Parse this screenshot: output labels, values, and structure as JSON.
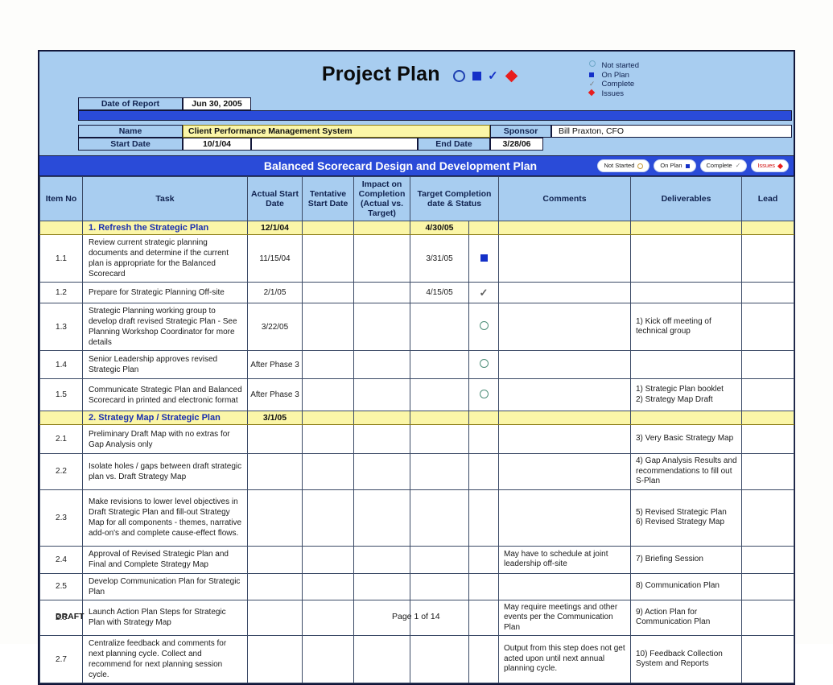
{
  "document": {
    "title": "Project Plan",
    "title_icons": [
      "not-started-circle",
      "on-plan-square",
      "complete-check",
      "issues-diamond"
    ]
  },
  "legend": {
    "items": [
      {
        "icon": "circle-outline",
        "label": "Not started"
      },
      {
        "icon": "blue-square",
        "label": "On Plan"
      },
      {
        "icon": "check",
        "label": "Complete"
      },
      {
        "icon": "red-diamond",
        "label": "Issues"
      }
    ]
  },
  "info": {
    "date_of_report_label": "Date of Report",
    "date_of_report_value": "Jun 30, 2005",
    "name_label": "Name",
    "name_value": "Client Performance Management System",
    "sponsor_label": "Sponsor",
    "sponsor_value": "Bill Praxton, CFO",
    "start_date_label": "Start Date",
    "start_date_value": "10/1/04",
    "end_date_label": "End Date",
    "end_date_value": "3/28/06"
  },
  "plan_bar": {
    "title": "Balanced Scorecard Design and Development Plan",
    "pills": [
      {
        "label": "Not Started",
        "icon": "circle-outline"
      },
      {
        "label": "On Plan",
        "icon": "blue-square"
      },
      {
        "label": "Complete",
        "icon": "check"
      },
      {
        "label": "Issues",
        "icon": "red-diamond"
      }
    ]
  },
  "table": {
    "headers": {
      "item_no": "Item No",
      "task": "Task",
      "actual_start_date": "Actual Start Date",
      "tentative_start_date": "Tentative Start Date",
      "impact_on_completion": "Impact on Completion (Actual vs. Target)",
      "target_completion": "Target Completion date & Status",
      "comments": "Comments",
      "deliverables": "Deliverables",
      "lead": "Lead"
    },
    "sections": [
      {
        "title": "1. Refresh the Strategic Plan",
        "actual_start": "12/1/04",
        "target_completion": "4/30/05",
        "rows": [
          {
            "item_no": "1.1",
            "task": "Review current strategic planning documents and determine if the current plan is appropriate for the Balanced Scorecard",
            "actual_start": "11/15/04",
            "tentative_start": "",
            "impact": "",
            "target_date": "3/31/05",
            "status": "on-plan",
            "comments": "",
            "deliverables": "",
            "lead": ""
          },
          {
            "item_no": "1.2",
            "task": "Prepare for Strategic Planning Off-site",
            "actual_start": "2/1/05",
            "tentative_start": "",
            "impact": "",
            "target_date": "4/15/05",
            "status": "complete",
            "comments": "",
            "deliverables": "",
            "lead": ""
          },
          {
            "item_no": "1.3",
            "task": "Strategic Planning working group to develop draft revised Strategic Plan - See Planning Workshop Coordinator for more details",
            "actual_start": "3/22/05",
            "tentative_start": "",
            "impact": "",
            "target_date": "",
            "status": "not-started",
            "comments": "",
            "deliverables": "1) Kick off meeting of technical group",
            "lead": ""
          },
          {
            "item_no": "1.4",
            "task": "Senior Leadership approves revised Strategic Plan",
            "actual_start": "After Phase 3",
            "tentative_start": "",
            "impact": "",
            "target_date": "",
            "status": "not-started",
            "comments": "",
            "deliverables": "",
            "lead": ""
          },
          {
            "item_no": "1.5",
            "task": "Communicate Strategic Plan and Balanced Scorecard in printed and electronic format",
            "actual_start": "After Phase 3",
            "tentative_start": "",
            "impact": "",
            "target_date": "",
            "status": "not-started",
            "comments": "",
            "deliverables": "1) Strategic Plan booklet\n2) Strategy Map Draft",
            "lead": ""
          }
        ]
      },
      {
        "title": "2. Strategy Map / Strategic Plan",
        "actual_start": "3/1/05",
        "target_completion": "",
        "rows": [
          {
            "item_no": "2.1",
            "task": "Preliminary Draft Map with no extras for Gap Analysis only",
            "actual_start": "",
            "tentative_start": "",
            "impact": "",
            "target_date": "",
            "status": "",
            "comments": "",
            "deliverables": "3) Very Basic Strategy Map",
            "lead": ""
          },
          {
            "item_no": "2.2",
            "task": "Isolate holes / gaps between draft strategic plan vs. Draft Strategy Map",
            "actual_start": "",
            "tentative_start": "",
            "impact": "",
            "target_date": "",
            "status": "",
            "comments": "",
            "deliverables": "4) Gap Analysis Results and recommendations to fill out S-Plan",
            "lead": ""
          },
          {
            "item_no": "2.3",
            "task": "Make revisions to lower level objectives in Draft Strategic Plan and fill-out Strategy Map for all components - themes, narrative add-on's and complete cause-effect flows.",
            "actual_start": "",
            "tentative_start": "",
            "impact": "",
            "target_date": "",
            "status": "",
            "comments": "",
            "deliverables": "5) Revised Strategic Plan\n6) Revised Strategy Map",
            "lead": ""
          },
          {
            "item_no": "2.4",
            "task": "Approval of Revised Strategic Plan and Final and Complete Strategy Map",
            "actual_start": "",
            "tentative_start": "",
            "impact": "",
            "target_date": "",
            "status": "",
            "comments": "May have to schedule at joint leadership off-site",
            "deliverables": "7) Briefing Session",
            "lead": ""
          },
          {
            "item_no": "2.5",
            "task": "Develop Communication Plan for Strategic Plan",
            "actual_start": "",
            "tentative_start": "",
            "impact": "",
            "target_date": "",
            "status": "",
            "comments": "",
            "deliverables": "8) Communication Plan",
            "lead": ""
          },
          {
            "item_no": "2.6",
            "task": "Launch Action Plan Steps for Strategic Plan with Strategy Map",
            "actual_start": "",
            "tentative_start": "",
            "impact": "",
            "target_date": "",
            "status": "",
            "comments": "May require meetings and other events per the Communication Plan",
            "deliverables": "9) Action Plan for Communication Plan",
            "lead": ""
          },
          {
            "item_no": "2.7",
            "task": "Centralize feedback and comments for next planning cycle. Collect and recommend for next planning session cycle.",
            "actual_start": "",
            "tentative_start": "",
            "impact": "",
            "target_date": "",
            "status": "",
            "comments": "Output from this step does not get acted upon until next annual planning cycle.",
            "deliverables": "10) Feedback Collection System and Reports",
            "lead": ""
          }
        ]
      }
    ]
  },
  "footer": {
    "draft": "DRAFT",
    "page": "Page 1 of 14"
  }
}
